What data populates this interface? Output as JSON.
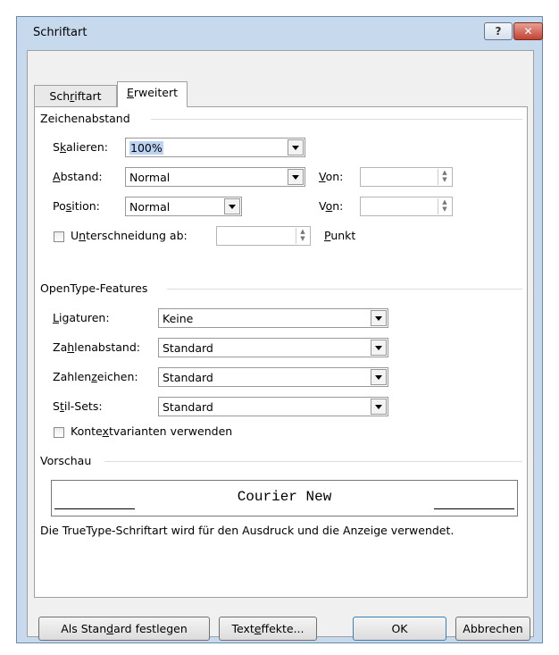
{
  "window": {
    "title": "Schriftart",
    "help_label": "?",
    "close_label": "✕"
  },
  "tabs": [
    {
      "label_pre": "Sch",
      "label_u": "r",
      "label_post": "iftart",
      "active": false
    },
    {
      "label_pre": "",
      "label_u": "E",
      "label_post": "rweitert",
      "active": true
    }
  ],
  "zeichenabstand": {
    "group_label": "Zeichenabstand",
    "skalieren_pre": "S",
    "skalieren_u": "k",
    "skalieren_post": "alieren:",
    "skalieren_value": "100%",
    "abstand_pre": "",
    "abstand_u": "A",
    "abstand_post": "bstand:",
    "abstand_value": "Normal",
    "position_pre": "Po",
    "position_u": "s",
    "position_post": "ition:",
    "position_value": "Normal",
    "von1_pre": "",
    "von1_u": "V",
    "von1_post": "on:",
    "von2_pre": "V",
    "von2_u": "o",
    "von2_post": "n:",
    "kerning_pre": "U",
    "kerning_u": "n",
    "kerning_post": "terschneidung ab:",
    "punkt_pre": "",
    "punkt_u": "P",
    "punkt_post": "unkt"
  },
  "opentype": {
    "group_label": "OpenType-Features",
    "ligaturen_pre": "",
    "ligaturen_u": "L",
    "ligaturen_post": "igaturen:",
    "ligaturen_value": "Keine",
    "zahlenabstand_pre": "Za",
    "zahlenabstand_u": "h",
    "zahlenabstand_post": "lenabstand:",
    "zahlenabstand_value": "Standard",
    "zahlenzeichen_pre": "Zahlen",
    "zahlenzeichen_u": "z",
    "zahlenzeichen_post": "eichen:",
    "zahlenzeichen_value": "Standard",
    "stilsets_pre": "S",
    "stilsets_u": "t",
    "stilsets_post": "il-Sets:",
    "stilsets_value": "Standard",
    "kontext_pre": "Konte",
    "kontext_u": "x",
    "kontext_post": "tvarianten verwenden"
  },
  "vorschau": {
    "group_label": "Vorschau",
    "preview_text": "Courier New",
    "note": "Die TrueType-Schriftart wird für den Ausdruck und die Anzeige verwendet."
  },
  "buttons": {
    "default_pre": "Als Stan",
    "default_u": "d",
    "default_post": "ard festlegen",
    "effects_pre": "Text",
    "effects_u": "e",
    "effects_post": "ffekte...",
    "ok": "OK",
    "cancel": "Abbrechen"
  }
}
